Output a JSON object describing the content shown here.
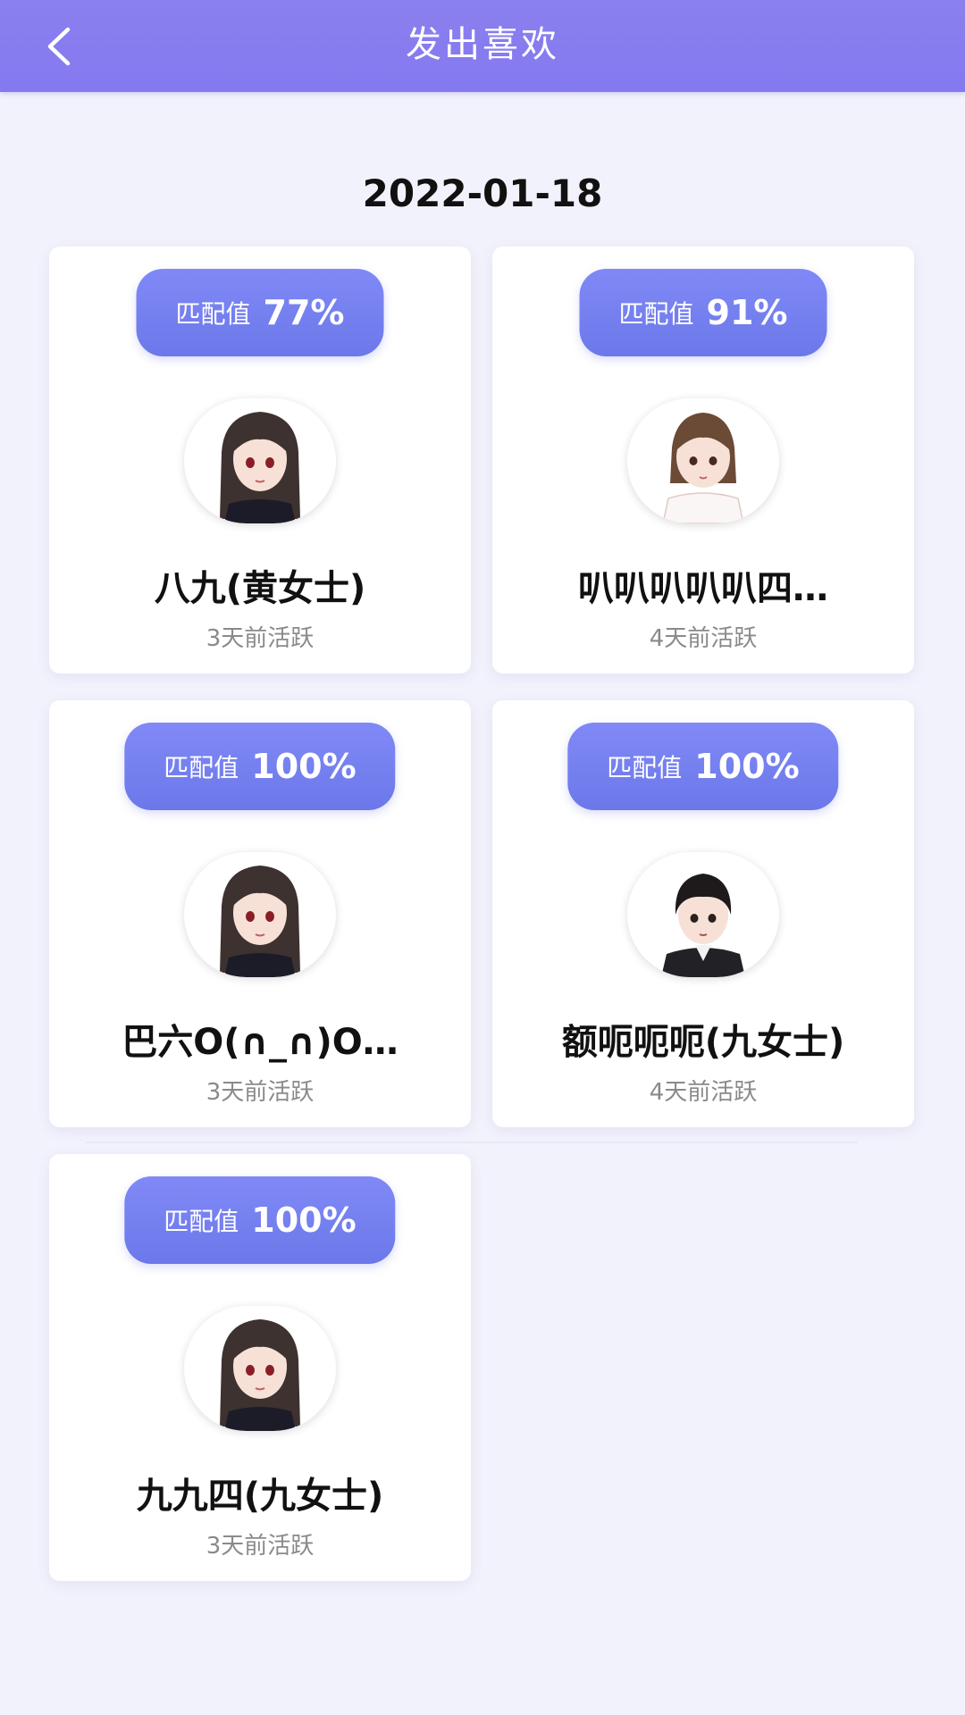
{
  "header": {
    "title": "发出喜欢",
    "back_icon": "chevron-left-icon"
  },
  "date": "2022-01-18",
  "match_label": "匹配值",
  "users": [
    {
      "name": "八九(黄女士)",
      "match": "77%",
      "active": "3天前活跃",
      "avatar": "girl-long-hair-avatar"
    },
    {
      "name": "叭叭叭叭叭四…",
      "match": "91%",
      "active": "4天前活跃",
      "avatar": "girl-short-hair-avatar"
    },
    {
      "name": "巴六O(∩_∩)O…",
      "match": "100%",
      "active": "3天前活跃",
      "avatar": "girl-long-hair-avatar"
    },
    {
      "name": "额呃呃呃(九女士)",
      "match": "100%",
      "active": "4天前活跃",
      "avatar": "boy-avatar"
    },
    {
      "name": "九九四(九女士)",
      "match": "100%",
      "active": "3天前活跃",
      "avatar": "girl-long-hair-avatar"
    }
  ],
  "colors": {
    "header": "#8a80ee",
    "pill": "#7480f0",
    "background": "#f2f2fc"
  }
}
